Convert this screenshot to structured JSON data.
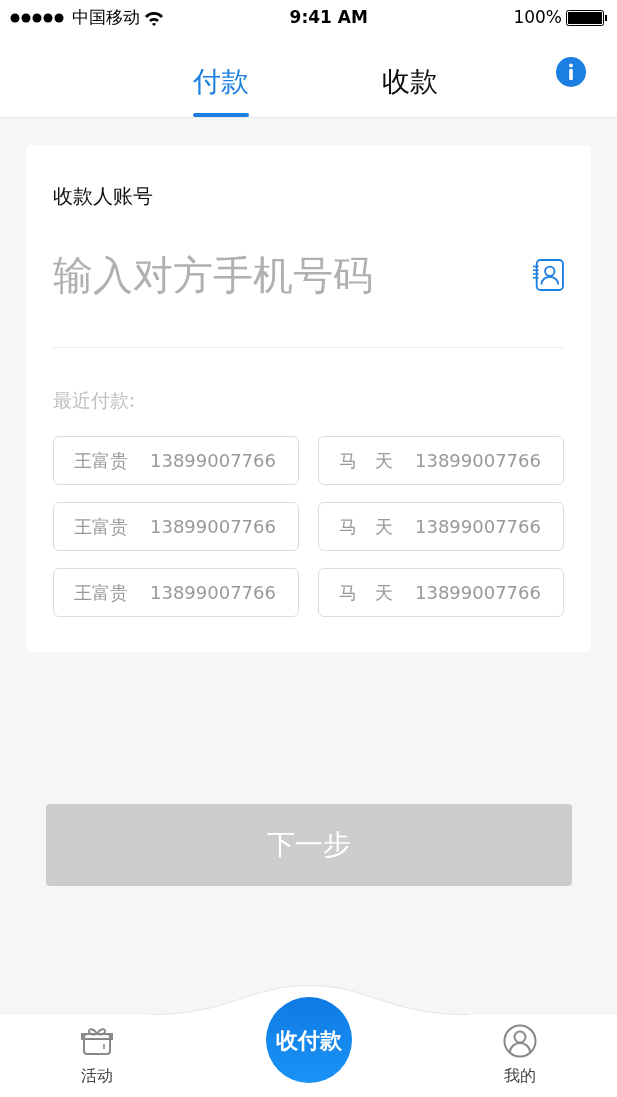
{
  "status_bar": {
    "carrier": "中国移动",
    "time": "9:41 AM",
    "battery": "100%"
  },
  "tabs": [
    {
      "label": "付款",
      "selected": true
    },
    {
      "label": "收款",
      "selected": false
    }
  ],
  "form": {
    "label": "收款人账号",
    "placeholder": "输入对方手机号码",
    "recent_title": "最近付款:"
  },
  "recent": [
    {
      "name": "王富贵",
      "phone": "13899007766"
    },
    {
      "name": "马　天",
      "phone": "13899007766"
    },
    {
      "name": "王富贵",
      "phone": "13899007766"
    },
    {
      "name": "马　天",
      "phone": "13899007766"
    },
    {
      "name": "王富贵",
      "phone": "13899007766"
    },
    {
      "name": "马　天",
      "phone": "13899007766"
    }
  ],
  "next_button": {
    "label": "下一步",
    "disabled": true
  },
  "bottom_nav": [
    {
      "kind": "gift",
      "label": "活动"
    },
    {
      "kind": "center",
      "label": "收付款"
    },
    {
      "kind": "user",
      "label": "我的"
    }
  ]
}
